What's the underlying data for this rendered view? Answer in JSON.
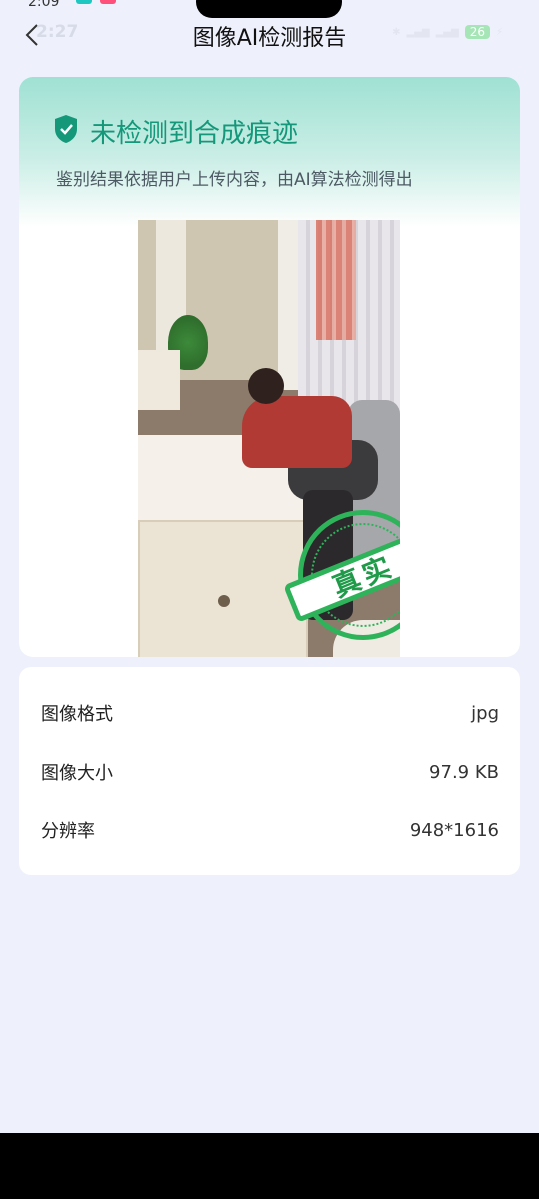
{
  "status_bar": {
    "time": "2:09",
    "battery": "26"
  },
  "header": {
    "title": "图像AI检测报告",
    "ghost_time": "2:27",
    "battery": "26"
  },
  "result": {
    "title": "未检测到合成痕迹",
    "subtitle": "鉴别结果依据用户上传内容，由AI算法检测得出",
    "stamp_text": "真实",
    "accent_color": "#15987a",
    "stamp_color": "#2fb35a"
  },
  "info": {
    "rows": [
      {
        "label": "图像格式",
        "value": "jpg"
      },
      {
        "label": "图像大小",
        "value": "97.9 KB"
      },
      {
        "label": "分辨率",
        "value": "948*1616"
      }
    ]
  },
  "icons": {
    "back": "chevron-left-icon",
    "shield": "shield-check-icon"
  }
}
